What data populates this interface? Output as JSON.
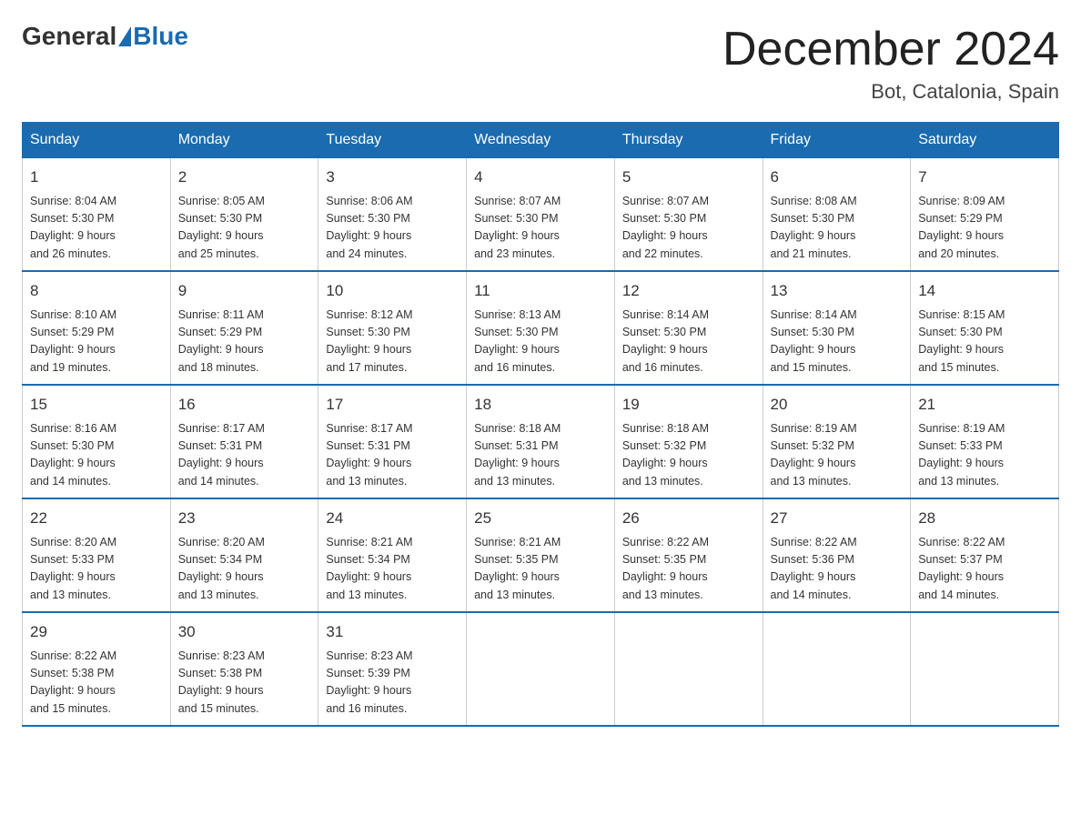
{
  "header": {
    "logo_general": "General",
    "logo_blue": "Blue",
    "month_title": "December 2024",
    "location": "Bot, Catalonia, Spain"
  },
  "days_of_week": [
    "Sunday",
    "Monday",
    "Tuesday",
    "Wednesday",
    "Thursday",
    "Friday",
    "Saturday"
  ],
  "weeks": [
    [
      {
        "day": "1",
        "sunrise": "8:04 AM",
        "sunset": "5:30 PM",
        "daylight": "9 hours and 26 minutes."
      },
      {
        "day": "2",
        "sunrise": "8:05 AM",
        "sunset": "5:30 PM",
        "daylight": "9 hours and 25 minutes."
      },
      {
        "day": "3",
        "sunrise": "8:06 AM",
        "sunset": "5:30 PM",
        "daylight": "9 hours and 24 minutes."
      },
      {
        "day": "4",
        "sunrise": "8:07 AM",
        "sunset": "5:30 PM",
        "daylight": "9 hours and 23 minutes."
      },
      {
        "day": "5",
        "sunrise": "8:07 AM",
        "sunset": "5:30 PM",
        "daylight": "9 hours and 22 minutes."
      },
      {
        "day": "6",
        "sunrise": "8:08 AM",
        "sunset": "5:30 PM",
        "daylight": "9 hours and 21 minutes."
      },
      {
        "day": "7",
        "sunrise": "8:09 AM",
        "sunset": "5:29 PM",
        "daylight": "9 hours and 20 minutes."
      }
    ],
    [
      {
        "day": "8",
        "sunrise": "8:10 AM",
        "sunset": "5:29 PM",
        "daylight": "9 hours and 19 minutes."
      },
      {
        "day": "9",
        "sunrise": "8:11 AM",
        "sunset": "5:29 PM",
        "daylight": "9 hours and 18 minutes."
      },
      {
        "day": "10",
        "sunrise": "8:12 AM",
        "sunset": "5:30 PM",
        "daylight": "9 hours and 17 minutes."
      },
      {
        "day": "11",
        "sunrise": "8:13 AM",
        "sunset": "5:30 PM",
        "daylight": "9 hours and 16 minutes."
      },
      {
        "day": "12",
        "sunrise": "8:14 AM",
        "sunset": "5:30 PM",
        "daylight": "9 hours and 16 minutes."
      },
      {
        "day": "13",
        "sunrise": "8:14 AM",
        "sunset": "5:30 PM",
        "daylight": "9 hours and 15 minutes."
      },
      {
        "day": "14",
        "sunrise": "8:15 AM",
        "sunset": "5:30 PM",
        "daylight": "9 hours and 15 minutes."
      }
    ],
    [
      {
        "day": "15",
        "sunrise": "8:16 AM",
        "sunset": "5:30 PM",
        "daylight": "9 hours and 14 minutes."
      },
      {
        "day": "16",
        "sunrise": "8:17 AM",
        "sunset": "5:31 PM",
        "daylight": "9 hours and 14 minutes."
      },
      {
        "day": "17",
        "sunrise": "8:17 AM",
        "sunset": "5:31 PM",
        "daylight": "9 hours and 13 minutes."
      },
      {
        "day": "18",
        "sunrise": "8:18 AM",
        "sunset": "5:31 PM",
        "daylight": "9 hours and 13 minutes."
      },
      {
        "day": "19",
        "sunrise": "8:18 AM",
        "sunset": "5:32 PM",
        "daylight": "9 hours and 13 minutes."
      },
      {
        "day": "20",
        "sunrise": "8:19 AM",
        "sunset": "5:32 PM",
        "daylight": "9 hours and 13 minutes."
      },
      {
        "day": "21",
        "sunrise": "8:19 AM",
        "sunset": "5:33 PM",
        "daylight": "9 hours and 13 minutes."
      }
    ],
    [
      {
        "day": "22",
        "sunrise": "8:20 AM",
        "sunset": "5:33 PM",
        "daylight": "9 hours and 13 minutes."
      },
      {
        "day": "23",
        "sunrise": "8:20 AM",
        "sunset": "5:34 PM",
        "daylight": "9 hours and 13 minutes."
      },
      {
        "day": "24",
        "sunrise": "8:21 AM",
        "sunset": "5:34 PM",
        "daylight": "9 hours and 13 minutes."
      },
      {
        "day": "25",
        "sunrise": "8:21 AM",
        "sunset": "5:35 PM",
        "daylight": "9 hours and 13 minutes."
      },
      {
        "day": "26",
        "sunrise": "8:22 AM",
        "sunset": "5:35 PM",
        "daylight": "9 hours and 13 minutes."
      },
      {
        "day": "27",
        "sunrise": "8:22 AM",
        "sunset": "5:36 PM",
        "daylight": "9 hours and 14 minutes."
      },
      {
        "day": "28",
        "sunrise": "8:22 AM",
        "sunset": "5:37 PM",
        "daylight": "9 hours and 14 minutes."
      }
    ],
    [
      {
        "day": "29",
        "sunrise": "8:22 AM",
        "sunset": "5:38 PM",
        "daylight": "9 hours and 15 minutes."
      },
      {
        "day": "30",
        "sunrise": "8:23 AM",
        "sunset": "5:38 PM",
        "daylight": "9 hours and 15 minutes."
      },
      {
        "day": "31",
        "sunrise": "8:23 AM",
        "sunset": "5:39 PM",
        "daylight": "9 hours and 16 minutes."
      },
      null,
      null,
      null,
      null
    ]
  ]
}
